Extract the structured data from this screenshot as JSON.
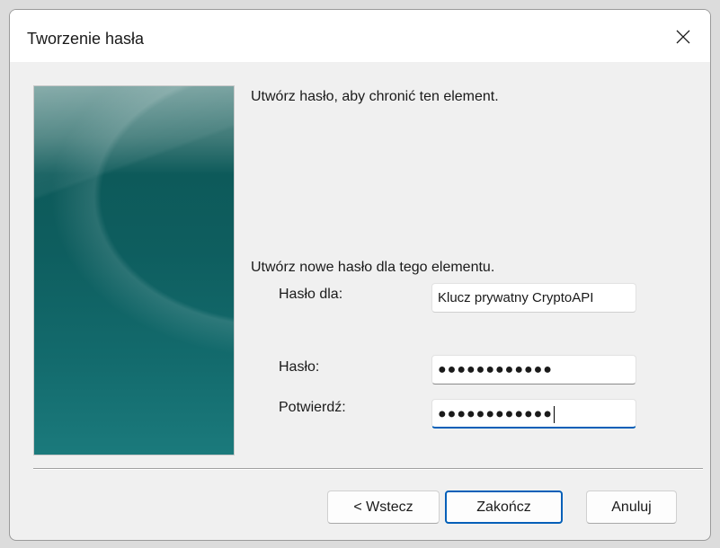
{
  "window": {
    "title": "Tworzenie hasła",
    "close_icon": "close-icon"
  },
  "banner": {
    "colors": [
      "#6d9a98",
      "#0d5a5a",
      "#1b7a7c"
    ]
  },
  "content": {
    "intro": "Utwórz hasło, aby chronić ten element.",
    "instruction": "Utwórz nowe hasło dla tego elementu.",
    "password_for_label": "Hasło dla:",
    "password_for_value": "Klucz prywatny CryptoAPI",
    "password_label": "Hasło:",
    "password_value": "●●●●●●●●●●●●",
    "confirm_label": "Potwierdź:",
    "confirm_value": "●●●●●●●●●●●●"
  },
  "buttons": {
    "back": "< Wstecz",
    "finish": "Zakończ",
    "cancel": "Anuluj"
  },
  "colors": {
    "accent": "#005fb8"
  }
}
